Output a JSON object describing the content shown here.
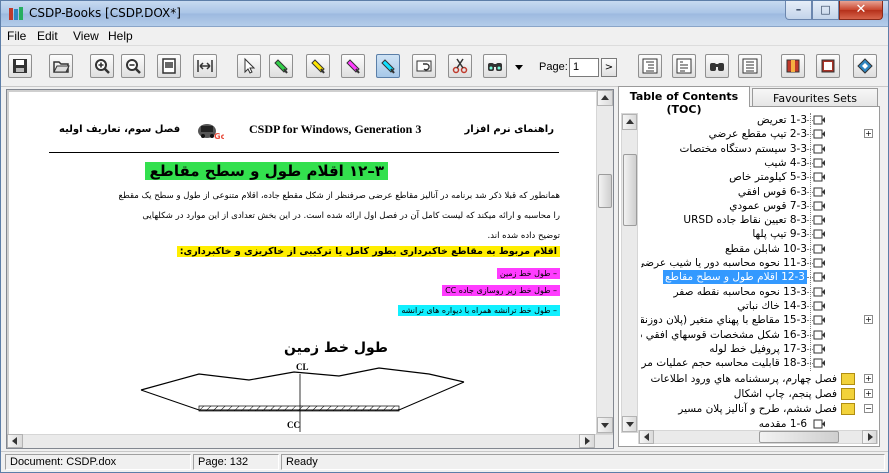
{
  "window": {
    "title": "CSDP-Books [CSDP.DOX*]",
    "minimize_glyph": "–",
    "maximize_glyph": "□",
    "close_glyph": "✕"
  },
  "menu": [
    "File",
    "Edit",
    "View",
    "Help"
  ],
  "toolbar": {
    "page_label": "Page:",
    "page_value": "1",
    "go_glyph": ">"
  },
  "document": {
    "header_right": "راهنمای نرم افزار",
    "header_title": "CSDP for Windows, Generation 3",
    "header_left": "فصل سوم، تعاریف اولیه",
    "section_title": "۳–۱۲ اقلام طول و سطح مقاطع",
    "paragraph_1": "همانطور که قبلا ذکر شد برنامه در آنالیز مقاطع عرضی صرفنظر از شکل مقطع جاده، اقلام متنوعی از طول و سطح یک مقطع",
    "paragraph_2": "را محاسبه و ارائه میکند که لیست کامل آن در فصل اول ارائه شده است. در این بخش تعدادی از این موارد در شکلهایی",
    "paragraph_3": "توضیح داده شده اند.",
    "subheading": "اقلام مربوط به مقاطع خاکبرداری بطور کامل یا ترکیبی از خاکریزی و خاکبرداری:",
    "bullets": [
      "– طول خط زمین",
      "– طول خط زیر روسازی جاده CC",
      "– طول خط ترانشه همراه با دیواره های ترانشه"
    ],
    "diagram_title": "طول خط زمین",
    "diagram_cl": "CL",
    "diagram_cc": "CC"
  },
  "toc": {
    "tabs": [
      "Table of Contents (TOC)",
      "Favourites Sets"
    ],
    "items": [
      {
        "label": "1-3 تعريض",
        "selected": false,
        "expander": ""
      },
      {
        "label": "2-3 تيپ مقطع عرضي",
        "selected": false,
        "expander": "+"
      },
      {
        "label": "3-3 سيستم دستگاه مختصات",
        "selected": false,
        "expander": ""
      },
      {
        "label": "4-3 شيب",
        "selected": false,
        "expander": ""
      },
      {
        "label": "5-3 كيلومتر خاص",
        "selected": false,
        "expander": ""
      },
      {
        "label": "6-3 قوس افقي",
        "selected": false,
        "expander": ""
      },
      {
        "label": "7-3 قوس عمودي",
        "selected": false,
        "expander": ""
      },
      {
        "label": "8-3 تعيين نقاط جاده URSD",
        "selected": false,
        "expander": ""
      },
      {
        "label": "9-3 تيپ پلها",
        "selected": false,
        "expander": ""
      },
      {
        "label": "10-3 شابلن مقطع",
        "selected": false,
        "expander": ""
      },
      {
        "label": "11-3 نحوه محاسبه دور يا شيب عرضي",
        "selected": false,
        "expander": ""
      },
      {
        "label": "12-3 اقلام طول و سطح مقاطع",
        "selected": true,
        "expander": ""
      },
      {
        "label": "13-3 نحوه محاسبه نقطه صفر",
        "selected": false,
        "expander": ""
      },
      {
        "label": "14-3 خاك نباتي",
        "selected": false,
        "expander": ""
      },
      {
        "label": "15-3 مقاطع با پهناي متغير (پلان دوزنقه ا",
        "selected": false,
        "expander": "+"
      },
      {
        "label": "16-3 شكل مشخصات قوسهاي افقي در پر",
        "selected": false,
        "expander": ""
      },
      {
        "label": "17-3 پروفيل خط لوله",
        "selected": false,
        "expander": ""
      },
      {
        "label": "18-3 قابليت محاسبه حجم عمليات مربوط ب",
        "selected": false,
        "expander": ""
      }
    ],
    "chapters": [
      {
        "label": "فصل چهارم، پرسشنامه هاي ورود اطلاعات",
        "expander": "+"
      },
      {
        "label": "فصل پنجم، چاپ اشكال",
        "expander": "+"
      },
      {
        "label": "فصل ششم، طرح و آناليز پلان مسير",
        "expander": "−"
      }
    ],
    "partial_item": "1-6 مقدمه"
  },
  "status": {
    "document": "Document: CSDP.dox",
    "page": "Page: 132",
    "state": "Ready"
  },
  "colors": {
    "section_highlight": "#33e04e",
    "subheading_highlight": "#ffee00",
    "magenta_highlight": "#ff3cff",
    "cyan_highlight": "#11f0ff",
    "selection": "#3399ff"
  }
}
